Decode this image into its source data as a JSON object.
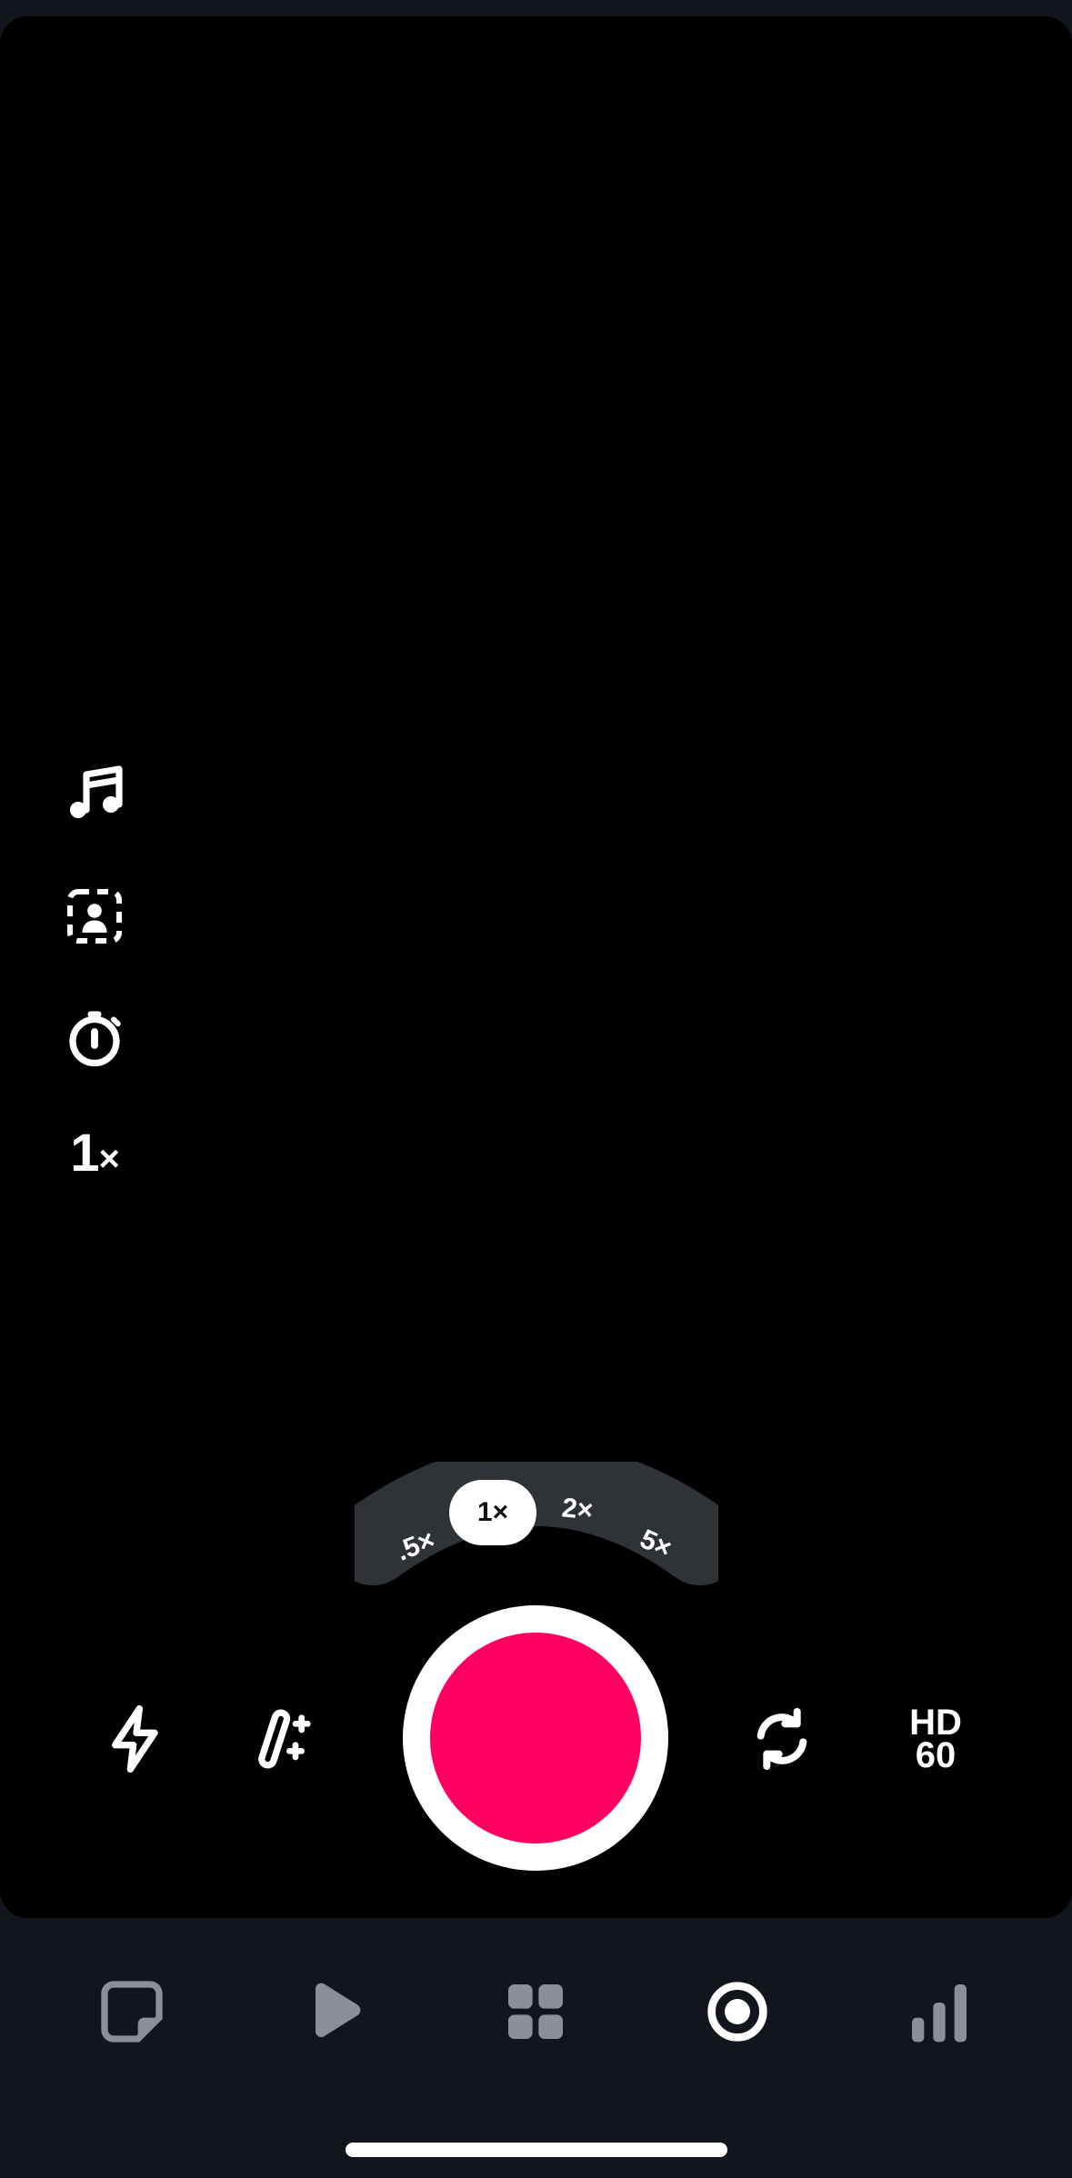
{
  "side_tools": {
    "music_icon": "music-note-icon",
    "green_screen_icon": "green-screen-icon",
    "timer_icon": "timer-icon",
    "speed": {
      "value": "1",
      "suffix": "×"
    }
  },
  "zoom": {
    "options": [
      ".5×",
      "1×",
      "2×",
      "5×"
    ],
    "selected": "1×"
  },
  "bottom_tools": {
    "flash_icon": "flash-icon",
    "effects_icon": "magic-wand-icon",
    "record_color": "#ff0061",
    "flip_icon": "flip-camera-icon",
    "quality_line1": "HD",
    "quality_line2": "60"
  },
  "tabbar": {
    "tabs": [
      {
        "icon": "sticky-note-icon",
        "active": false
      },
      {
        "icon": "play-icon",
        "active": false
      },
      {
        "icon": "grid-icon",
        "active": false
      },
      {
        "icon": "record-icon",
        "active": true
      },
      {
        "icon": "stats-bars-icon",
        "active": false
      }
    ]
  }
}
